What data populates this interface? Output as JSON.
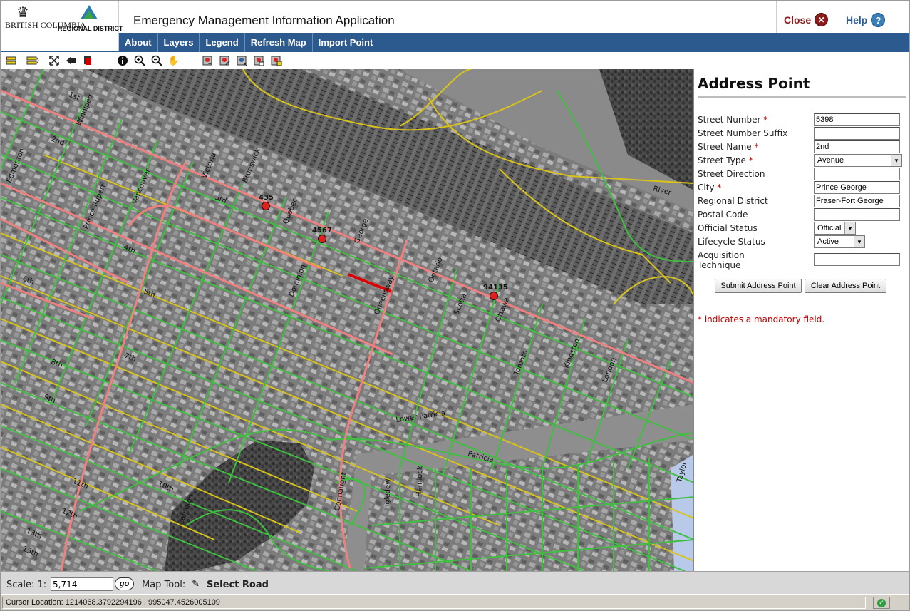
{
  "app": {
    "title": "Emergency Management Information Application",
    "logo_bc_text": "BRITISH COLUMBIA",
    "logo_rd_text": "REGIONAL DISTRICT"
  },
  "header": {
    "close_label": "Close",
    "help_label": "Help"
  },
  "nav": {
    "items": [
      "About",
      "Layers",
      "Legend",
      "Refresh Map",
      "Import Point"
    ]
  },
  "toolbar": {
    "icons": [
      "layer-add-icon",
      "layer-toggle-icon",
      "full-extent-icon",
      "back-extent-icon",
      "delete-icon",
      "info-icon",
      "zoom-in-icon",
      "zoom-out-icon",
      "pan-icon",
      "add-point-icon",
      "edit-point-icon",
      "move-point-icon",
      "select-point-icon",
      "query-point-icon"
    ]
  },
  "map": {
    "address_points": [
      "435",
      "4567",
      "94135"
    ],
    "street_labels": [
      "1st",
      "2nd",
      "3rd",
      "4th",
      "5th",
      "6th",
      "7th",
      "8th",
      "9th",
      "10th",
      "11th",
      "12th",
      "13th",
      "15th",
      "Winnipeg",
      "Edmonton",
      "Vancouver",
      "Prince Rupert",
      "Victoria",
      "Brunswick",
      "Quebec",
      "Dominion",
      "George",
      "Queensway",
      "Ontario",
      "Ottawa",
      "Scotia",
      "Toronto",
      "Kingston",
      "London",
      "Patricia",
      "Lower Patricia",
      "River",
      "Connaught",
      "Cameron",
      "Ingledew",
      "Hemlock",
      "Taylor"
    ]
  },
  "panel": {
    "title": "Address Point",
    "fields": {
      "street_number": {
        "label": "Street Number",
        "required": "*",
        "value": "5398"
      },
      "street_number_suffix": {
        "label": "Street Number Suffix",
        "value": ""
      },
      "street_name": {
        "label": "Street Name",
        "required": "*",
        "value": "2nd"
      },
      "street_type": {
        "label": "Street Type",
        "required": "*",
        "value": "Avenue"
      },
      "street_direction": {
        "label": "Street Direction",
        "value": ""
      },
      "city": {
        "label": "City",
        "required": "*",
        "value": "Prince George"
      },
      "regional_district": {
        "label": "Regional District",
        "value": "Fraser-Fort George"
      },
      "postal_code": {
        "label": "Postal Code",
        "value": ""
      },
      "official_status": {
        "label": "Official Status",
        "value": "Official"
      },
      "lifecycle_status": {
        "label": "Lifecycle Status",
        "value": "Active"
      },
      "acquisition_technique": {
        "label_line1": "Acquisition",
        "label_line2": "Technique",
        "value": ""
      }
    },
    "submit_label": "Submit Address Point",
    "clear_label": "Clear Address Point",
    "mandatory_note": "* indicates a mandatory field."
  },
  "scalebar": {
    "scale_label": "Scale: 1:",
    "scale_value": "5,714",
    "go_label": "go",
    "map_tool_label": "Map Tool:",
    "map_tool_value": "Select Road"
  },
  "status": {
    "cursor_location": "Cursor Location: 1214068.3792294196 , 995047.4526005109"
  },
  "colors": {
    "nav_bg": "#2c5a8e",
    "arterial_road": "#f08080",
    "local_road": "#3fbf3f",
    "lane": "#d8c31a",
    "selected_road": "#dd0000",
    "address_point": "#e02020",
    "required_marker": "#c00000"
  }
}
